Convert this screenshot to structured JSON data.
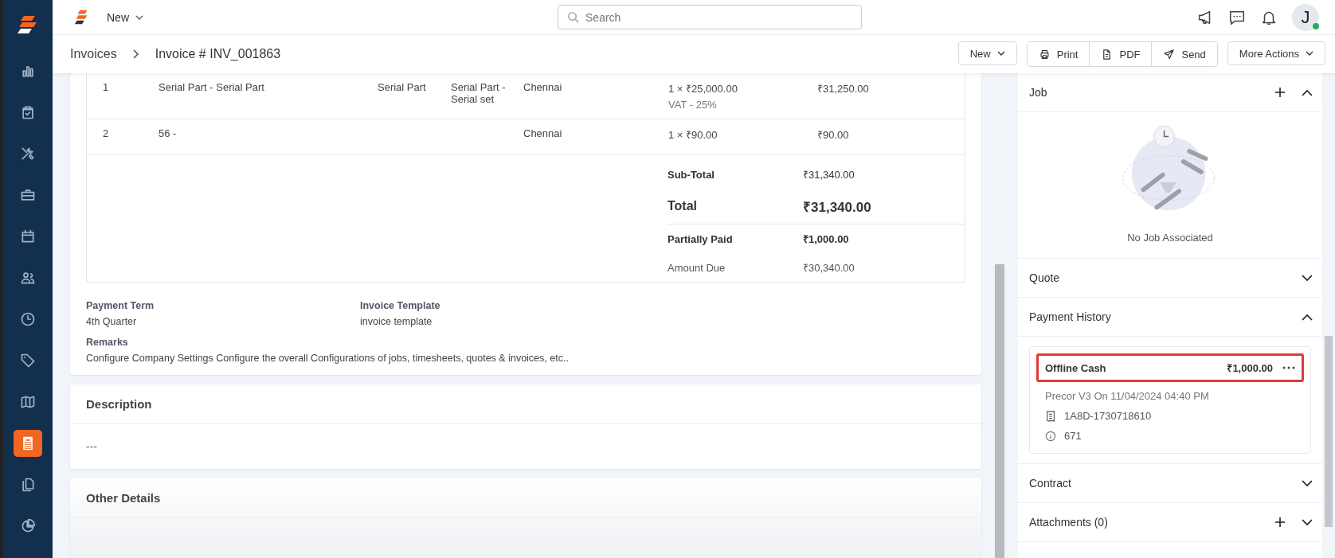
{
  "sidebar": {
    "items": [
      {
        "selected": false
      },
      {
        "selected": false
      },
      {
        "selected": false
      },
      {
        "selected": false
      },
      {
        "selected": false
      },
      {
        "selected": false
      },
      {
        "selected": false
      },
      {
        "selected": false
      },
      {
        "selected": false
      },
      {
        "selected": true
      },
      {
        "selected": false
      },
      {
        "selected": false
      }
    ]
  },
  "top_bar": {
    "new_menu": "New",
    "search": {
      "placeholder": "Search"
    },
    "avatar": {
      "initial": "J",
      "online": true
    }
  },
  "breadcrumb": [
    "Invoices",
    "Invoice # INV_001863"
  ],
  "actions": {
    "new": "New",
    "group": [
      {
        "label": "Print"
      },
      {
        "label": "PDF"
      },
      {
        "label": "Send"
      }
    ],
    "more": "More Actions"
  },
  "line_items": [
    {
      "number": "1",
      "item": "Serial Part - Serial Part",
      "column_3": "Serial Part",
      "column_4": "Serial Part - Serial set",
      "location": "Chennai",
      "quantity_price": "1 × ₹25,000.00",
      "tax": "VAT - 25%",
      "amount": "₹31,250.00"
    },
    {
      "number": "2",
      "item": "56 -",
      "location": "Chennai",
      "quantity_price": "1 × ₹90.00",
      "amount": "₹90.00"
    }
  ],
  "totals": [
    {
      "kind": "subtotal",
      "label": "Sub-Total",
      "value": "₹31,340.00"
    },
    {
      "kind": "total",
      "label": "Total",
      "value": "₹31,340.00"
    },
    {
      "kind": "paid",
      "label": "Partially Paid",
      "value": "₹1,000.00"
    },
    {
      "kind": "due",
      "label": "Amount Due",
      "value": "₹30,340.00"
    }
  ],
  "details": [
    {
      "label": "Payment Term",
      "value": "4th Quarter"
    },
    {
      "label": "Invoice Template",
      "value": "invoice template"
    }
  ],
  "remarks": {
    "label": "Remarks",
    "value": "Configure Company Settings Configure the overall Configurations of jobs, timesheets, quotes & invoices, etc.."
  },
  "description": {
    "title": "Description",
    "value": "---"
  },
  "other_details": {
    "title": "Other Details"
  },
  "right_panel": {
    "sections": [
      {
        "kind": "job",
        "title": "Job",
        "expanded": true,
        "can_add": true,
        "empty_text": "No Job Associated"
      },
      {
        "kind": "plain",
        "title": "Quote",
        "expanded": false,
        "can_add": false
      },
      {
        "kind": "payments",
        "title": "Payment History",
        "expanded": true,
        "can_add": false,
        "payments": [
          {
            "method": "Offline Cash",
            "amount": "₹1,000.00",
            "highlighted": true,
            "meta": "Precor V3 On 11/04/2024 04:40 PM",
            "reference": "1A8D-1730718610",
            "note": "671"
          }
        ]
      },
      {
        "kind": "plain",
        "title": "Contract",
        "expanded": false,
        "can_add": false
      },
      {
        "kind": "plain",
        "title": "Attachments (0)",
        "expanded": false,
        "can_add": true
      }
    ]
  }
}
